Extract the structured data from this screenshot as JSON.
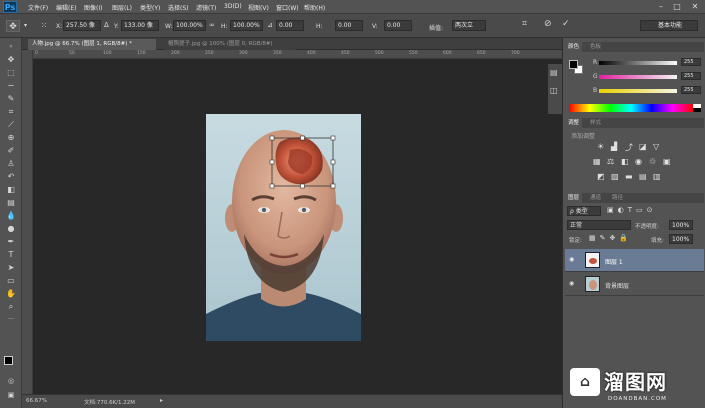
{
  "app": {
    "logo": "Ps"
  },
  "menu": [
    "文件(F)",
    "编辑(E)",
    "图像(I)",
    "图层(L)",
    "类型(Y)",
    "选择(S)",
    "滤镜(T)",
    "3D(D)",
    "视图(V)",
    "窗口(W)",
    "帮助(H)"
  ],
  "window_controls": {
    "minimize": "–",
    "restore": "□",
    "close": "✕"
  },
  "options": {
    "x_label": "X:",
    "x_value": "257.50 像",
    "y_label": "Y:",
    "y_value": "133.00 像",
    "w_label": "W:",
    "w_value": "100.00%",
    "h_label": "H:",
    "h_value": "100.00%",
    "angle_value": "0.00",
    "hskew_label": "H:",
    "hskew_value": "0.00",
    "vskew_label": "V:",
    "vskew_value": "0.00",
    "interp_label": "插值:",
    "interp_value": "两次立",
    "workspace_value": "基本功能"
  },
  "tabs": [
    {
      "label": "人物.jpg @ 66.7% (图层 1, RGB/8#) *",
      "active": true
    },
    {
      "label": "帽照提子.jpg @ 100% (图层 0, RGB/8#)",
      "active": false
    }
  ],
  "ruler_marks": [
    "0",
    "50",
    "100",
    "150",
    "200",
    "250",
    "300",
    "350",
    "400",
    "450",
    "500",
    "550",
    "600",
    "650",
    "700"
  ],
  "status": {
    "zoom": "66.67%",
    "doc": "文档:770.6K/1.22M"
  },
  "color_panel": {
    "tab_color": "颜色",
    "tab_swatches": "色板",
    "r_label": "R",
    "g_label": "G",
    "b_label": "B",
    "r_value": "255",
    "g_value": "255",
    "b_value": "255"
  },
  "adjustments": {
    "tab_adjust": "调整",
    "tab_styles": "样式",
    "title": "添加调整"
  },
  "layers_panel": {
    "tab_layers": "图层",
    "tab_channels": "通道",
    "tab_paths": "路径",
    "filter_type": "ρ 类型",
    "blend_mode": "正常",
    "opacity_label": "不透明度:",
    "opacity_value": "100%",
    "lock_label": "锁定:",
    "fill_label": "填充:",
    "fill_value": "100%",
    "layers": [
      {
        "name": "图层 1",
        "selected": true
      },
      {
        "name": "背景图层",
        "selected": false
      }
    ]
  },
  "watermark": {
    "text": "溜图网",
    "sub": "DOANDBAN.COM"
  },
  "colors": {
    "accent": "#31a8ff",
    "panel": "#535353",
    "canvas": "#282828",
    "selected_layer": "#6a7c95"
  }
}
